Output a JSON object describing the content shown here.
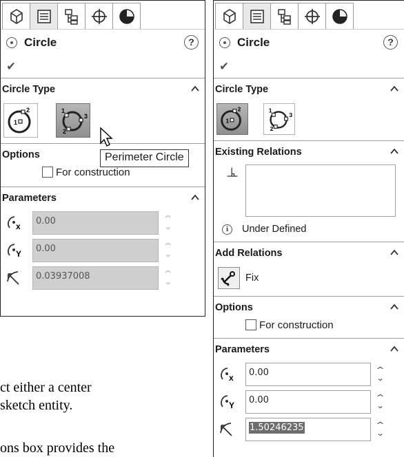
{
  "left_panel": {
    "tabs": [
      "feature-manager",
      "property-manager",
      "configuration-manager",
      "dimxpert-manager",
      "display-manager"
    ],
    "title": "Circle",
    "help": "?",
    "confirm": "✔",
    "circle_type": {
      "header": "Circle Type",
      "center_numbers": "1",
      "perimeter_numbers": [
        "1",
        "2",
        "3"
      ],
      "center_num2": "2"
    },
    "options": {
      "header": "Options",
      "construction_label": "For construction"
    },
    "parameters": {
      "header": "Parameters",
      "x": "0.00",
      "y": "0.00",
      "radius": "0.03937008"
    },
    "tooltip": "Perimeter Circle"
  },
  "right_panel": {
    "title": "Circle",
    "help": "?",
    "confirm": "✔",
    "circle_type": {
      "header": "Circle Type"
    },
    "existing_relations": {
      "header": "Existing Relations",
      "status": "Under Defined",
      "info": "i"
    },
    "add_relations": {
      "header": "Add Relations",
      "fix_label": "Fix"
    },
    "options": {
      "header": "Options",
      "construction_label": "For construction"
    },
    "parameters": {
      "header": "Parameters",
      "x": "0.00",
      "y": "0.00",
      "radius": "1.50246235"
    }
  },
  "doc_text": {
    "line1": "ct either a center",
    "line2": "sketch entity.",
    "line3": "ons box provides the"
  }
}
